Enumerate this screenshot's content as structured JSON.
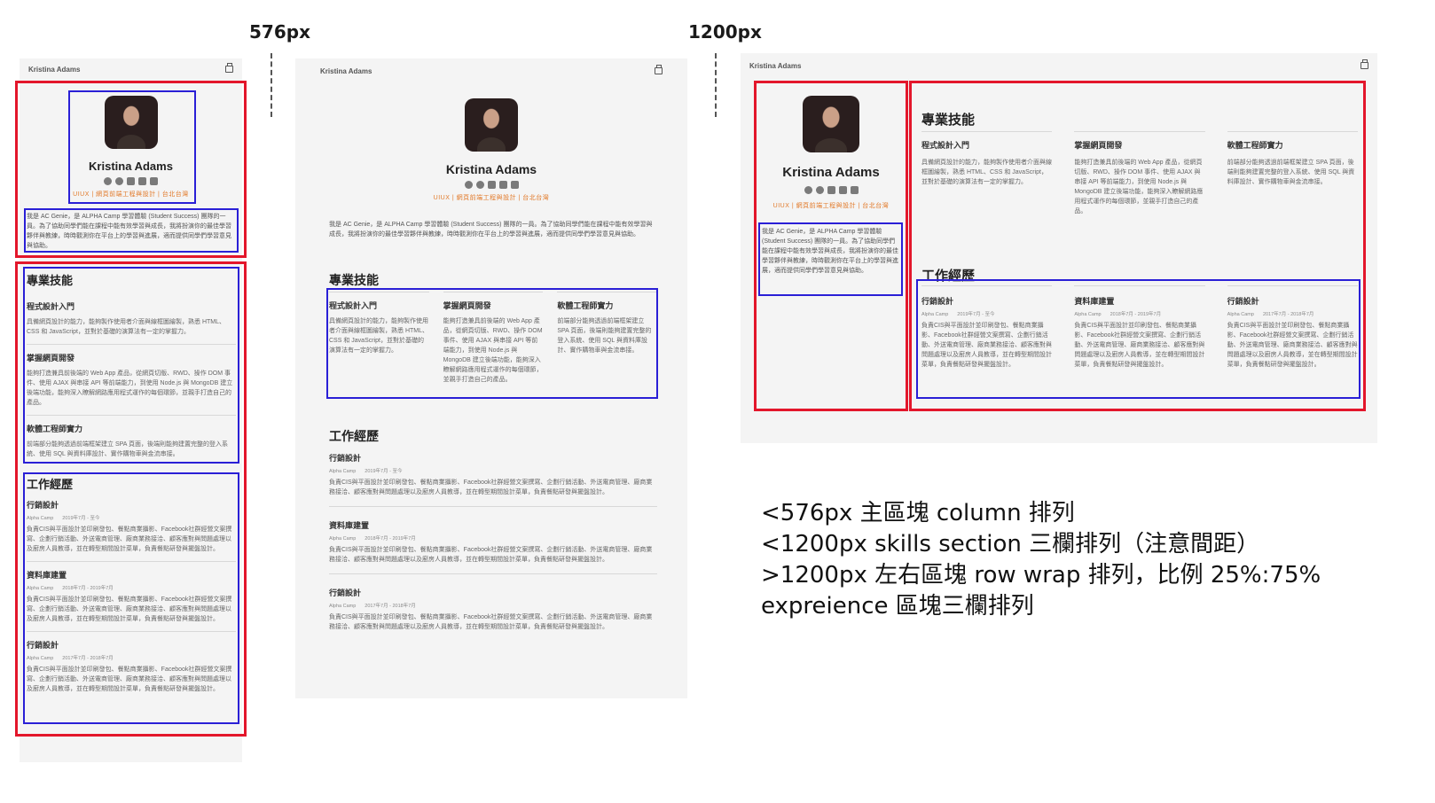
{
  "labels": {
    "bp_576": "576px",
    "bp_1200": "1200px"
  },
  "header": {
    "name": "Kristina Adams"
  },
  "profile": {
    "name": "Kristina Adams",
    "subtitle": "UIUX | 網頁前端工程與設計 | 台北台灣",
    "bio": "我是 AC Genie，是 ALPHA Camp 學習體驗 (Student Success) 團隊的一員。為了協助同學們能在課程中能有效學習與成長，我將扮演你的最佳學習夥伴與教練，時時觀測你在平台上的學習與進展，適而提供同學們學習意見與協助。",
    "social_icons": [
      "github-icon",
      "instagram-icon",
      "linkedin-icon",
      "youtube-icon",
      "email-icon"
    ]
  },
  "skills": {
    "title": "專業技能",
    "items": [
      {
        "title": "程式設計入門",
        "desc": "具備網頁設計的能力，能夠製作使用者介面與線框圖繪製，熟悉 HTML、CSS 和 JavaScript，並對於基礎的演算法有一定的掌握力。"
      },
      {
        "title": "掌握網頁開發",
        "desc": "能夠打造兼具前後端的 Web App 產品，從網頁切版、RWD、操作 DOM 事件、使用 AJAX 與串接 API 等前端能力，到使用 Node.js 與 MongoDB 建立後端功能，能夠深入瞭解網路應用程式運作的每個環節，並親手打造自己的產品。"
      },
      {
        "title": "軟體工程師實力",
        "desc": "前端部分能夠透過前端框架建立 SPA 頁面，後端則能夠建置完整的登入系統、使用 SQL 與資料庫設計、實作購物車與金流串接。"
      }
    ]
  },
  "experience": {
    "title": "工作經歷",
    "items": [
      {
        "title": "行銷設計",
        "company": "Alpha Camp",
        "date": "2019年7月 - 至今",
        "desc": "負責CIS與平面設計並印刷發包、餐點商業攝影、Facebook社群經營文案撰寫、企劃行銷活動、外送電商管理、廠商業務接洽、顧客應對與問題處理以及廚房人員教導，並在轉型期間設計菜單，負責餐點研發與擺盤設計。"
      },
      {
        "title": "資料庫建置",
        "company": "Alpha Camp",
        "date": "2018年7月 - 2019年7月",
        "desc": "負責CIS與平面設計並印刷發包、餐點商業攝影、Facebook社群經營文案撰寫、企劃行銷活動、外送電商管理、廠商業務接洽、顧客應對與問題處理以及廚房人員教導，並在轉型期間設計菜單，負責餐點研發與擺盤設計。"
      },
      {
        "title": "行銷設計",
        "company": "Alpha Camp",
        "date": "2017年7月 - 2018年7月",
        "desc": "負責CIS與平面設計並印刷發包、餐點商業攝影、Facebook社群經營文案撰寫、企劃行銷活動、外送電商管理、廠商業務接洽、顧客應對與問題處理以及廚房人員教導，並在轉型期間設計菜單，負責餐點研發與擺盤設計。"
      }
    ]
  },
  "notes": {
    "line1": "<576px 主區塊 column 排列",
    "line2": "<1200px skills section 三欄排列（注意間距）",
    "line3": ">1200px 左右區塊 row wrap 排列，比例 25%:75%",
    "line4": "expreience 區塊三欄排列"
  },
  "colors": {
    "red_outline": "#e3162b",
    "blue_outline": "#2a1fd6",
    "subtitle_orange": "#e27a2a",
    "mock_bg": "#f4f4f4"
  }
}
